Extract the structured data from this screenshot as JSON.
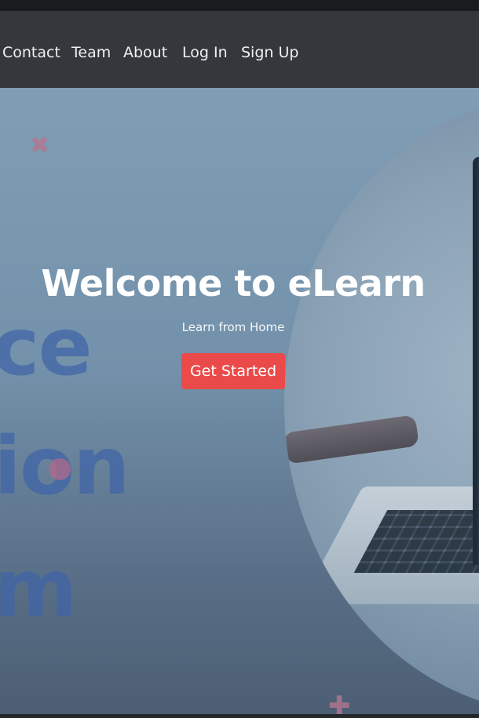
{
  "nav": {
    "items": [
      {
        "label": "Contact"
      },
      {
        "label": "Team"
      },
      {
        "label": "About"
      },
      {
        "label": "Log In"
      },
      {
        "label": "Sign Up"
      }
    ]
  },
  "hero": {
    "title": "Welcome to eLearn",
    "subtitle": "Learn from Home",
    "cta_label": "Get Started",
    "background_words": [
      "ce",
      "ion",
      "m"
    ]
  },
  "colors": {
    "navbar": "#34373c",
    "cta": "#ea4a4a",
    "background_text": "#3f64a8"
  },
  "icons": [
    "cross-decoration",
    "plus-decoration"
  ]
}
